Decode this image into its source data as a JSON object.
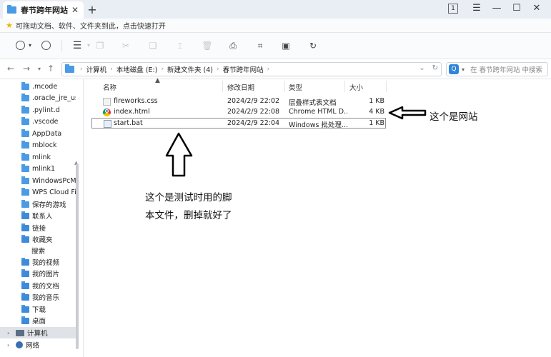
{
  "tab": {
    "title": "春节跨年网站",
    "close": "✕",
    "new_tab": "+"
  },
  "window_controls": {
    "tab_count": "1",
    "menu": "☰",
    "minimize": "—",
    "maximize": "☐",
    "close": "✕"
  },
  "bookmark_bar": {
    "text": "可拖动文档、软件、文件夹到此，点击快速打开"
  },
  "address_bar": {
    "breadcrumbs": [
      "计算机",
      "本地磁盘 (E:)",
      "新建文件夹 (4)",
      "春节跨年网站"
    ]
  },
  "search": {
    "placeholder": "在 春节跨年网站 中搜索"
  },
  "sidebar": {
    "items": [
      {
        "label": ".mcode",
        "icon": "folder-icon"
      },
      {
        "label": ".oracle_jre_usa",
        "icon": "folder-icon"
      },
      {
        "label": ".pylint.d",
        "icon": "folder-icon"
      },
      {
        "label": ".vscode",
        "icon": "folder-icon"
      },
      {
        "label": "AppData",
        "icon": "folder-icon"
      },
      {
        "label": "mblock",
        "icon": "folder-icon"
      },
      {
        "label": "mlink",
        "icon": "folder-icon"
      },
      {
        "label": "mlink1",
        "icon": "folder-icon"
      },
      {
        "label": "WindowsPcMa",
        "icon": "folder-icon"
      },
      {
        "label": "WPS Cloud File",
        "icon": "folder-icon"
      },
      {
        "label": "保存的游戏",
        "icon": "folder-icon"
      },
      {
        "label": "联系人",
        "icon": "contacts-icon"
      },
      {
        "label": "链接",
        "icon": "links-icon"
      },
      {
        "label": "收藏夹",
        "icon": "favorites-icon"
      },
      {
        "label": "搜索",
        "icon": "search-icon"
      },
      {
        "label": "我的视频",
        "icon": "videos-icon"
      },
      {
        "label": "我的图片",
        "icon": "pictures-icon"
      },
      {
        "label": "我的文档",
        "icon": "documents-icon"
      },
      {
        "label": "我的音乐",
        "icon": "music-icon"
      },
      {
        "label": "下载",
        "icon": "downloads-icon"
      },
      {
        "label": "桌面",
        "icon": "desktop-icon"
      }
    ],
    "computer": "计算机",
    "network": "网络"
  },
  "columns": {
    "name": "名称",
    "modified": "修改日期",
    "type": "类型",
    "size": "大小"
  },
  "files": [
    {
      "name": "fireworks.css",
      "modified": "2024/2/9 22:02",
      "type": "层叠样式表文档",
      "size": "1 KB",
      "icon": "css-file-icon"
    },
    {
      "name": "index.html",
      "modified": "2024/2/9 22:08",
      "type": "Chrome HTML D...",
      "size": "4 KB",
      "icon": "chrome-html-icon"
    },
    {
      "name": "start.bat",
      "modified": "2024/2/9 22:04",
      "type": "Windows 批处理...",
      "size": "1 KB",
      "icon": "batch-file-icon"
    }
  ],
  "annotations": {
    "website_note": "这个是网站",
    "script_note_line1": "这个是测试时用的脚",
    "script_note_line2": "本文件，删掉就好了"
  }
}
